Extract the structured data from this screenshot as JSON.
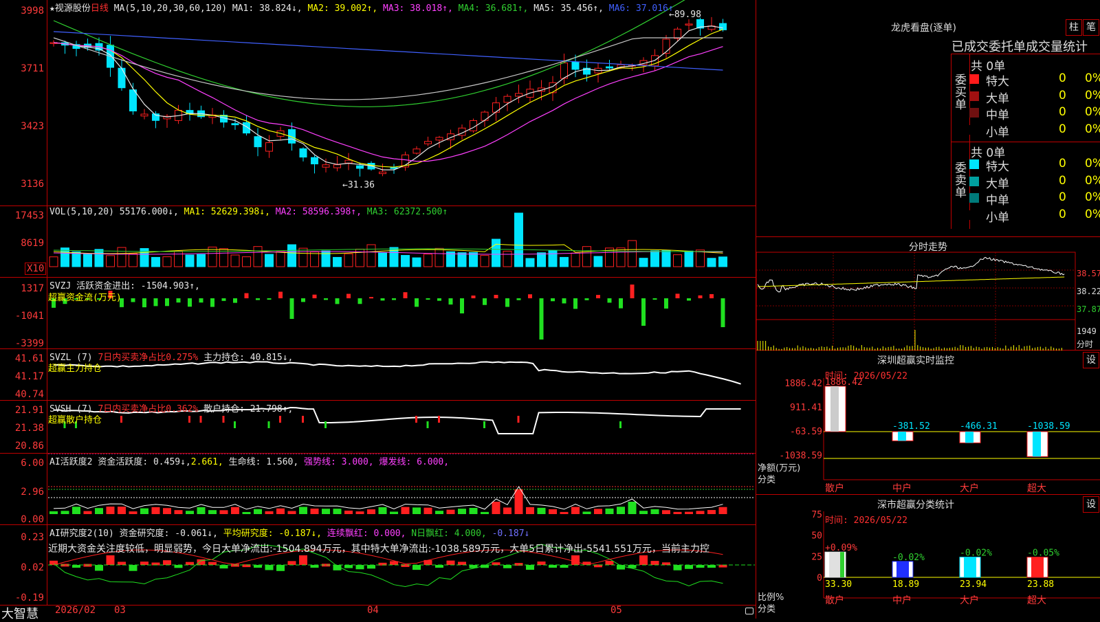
{
  "app": {
    "brand": "大智慧"
  },
  "kline": {
    "star": "★",
    "stock_name": "视源股份",
    "period": "日线",
    "ma_def": "MA(5,10,20,30,60,120)",
    "ma1": "MA1: 38.824↓,",
    "ma2": "MA2: 39.002↑,",
    "ma3": "MA3: 38.018↑,",
    "ma4": "MA4: 36.681↑,",
    "ma5": "MA5: 35.456↑,",
    "ma6": "MA6: 37.016↑",
    "y_ticks": [
      "3998",
      "3711",
      "3423",
      "3136"
    ],
    "high_label": "←89.98",
    "low_label": "←31.36",
    "colors": {
      "up": "#ff2020",
      "down": "#00e5ff",
      "ma1": "#e8e8e8",
      "ma2": "#ffff00",
      "ma3": "#ff40ff",
      "ma4": "#30d030",
      "ma5": "#4060ff",
      "ma6": "#c8c8c8"
    }
  },
  "vol": {
    "label": "VOL(5,10,20)",
    "value": "55176.000↓,",
    "ma1": "MA1: 52629.398↓,",
    "ma2": "MA2: 58596.398↑,",
    "ma3": "MA3: 62372.500↑",
    "y_ticks": [
      "17453",
      "8619"
    ],
    "multiplier": "X10"
  },
  "svzj": {
    "label": "SVZJ",
    "text": "活跃资金进出: -1504.903↑,",
    "subtitle": "超赢资金流(万元)",
    "y_ticks": [
      "1317",
      "-1041",
      "-3399"
    ]
  },
  "svzl": {
    "label": "SVZL (7)",
    "ratio": "7日内买卖净占比0.275%",
    "hold": "主力持仓: 40.815↓,",
    "subtitle": "超赢主力持仓",
    "y_ticks": [
      "41.61",
      "41.17",
      "40.74"
    ]
  },
  "svsh": {
    "label": "SVSH (7)",
    "ratio": "7日内买卖净占比0.362%",
    "hold": "散户持仓: 21.798↑,",
    "subtitle": "超赢散户持仓",
    "y_ticks": [
      "21.91",
      "21.38",
      "20.86"
    ]
  },
  "ai_active": {
    "label": "AI活跃度2",
    "text1": "资金活跃度: 0.459↓,",
    "text2": "2.661,",
    "text3": "生命线: 1.560,",
    "text4": "强势线: 3.000,",
    "text5": "爆发线: 6.000,",
    "y_ticks": [
      "6.00",
      "2.96",
      "0.00"
    ]
  },
  "ai_research": {
    "label": "AI研究度2(10)",
    "text1": "资金研究度: -0.061↓,",
    "text2": "平均研究度: -0.187↓,",
    "text3": "连续飘红: 0.000,",
    "text4": "N日飘红: 4.000,",
    "text5": "-0.187↓",
    "comment": "近期大资金关注度较低，明显弱势，今日大单净流出:-1504.894万元，其中特大单净流出:-1038.589万元，大单5日累计净出-5541.551万元，当前主力控",
    "y_ticks": [
      "0.23",
      "0.02",
      "-0.19"
    ]
  },
  "x_axis": {
    "labels": [
      "2026/02",
      "03",
      "04",
      "05"
    ]
  },
  "lhb": {
    "title": "龙虎看盘(逐单)",
    "btn_bar": "柱",
    "btn_pen": "笔",
    "tabs": "已成交委托单成交量统计",
    "buy_side": "委买单",
    "sell_side": "委卖单",
    "buy_total": "共 0单",
    "sell_total": "共 0单",
    "buy_rows": [
      {
        "label": "特大",
        "v1": "0",
        "v2": "0%",
        "color": "#ff1a1a"
      },
      {
        "label": "大单",
        "v1": "0",
        "v2": "0%",
        "color": "#a01010"
      },
      {
        "label": "中单",
        "v1": "0",
        "v2": "0%",
        "color": "#701010"
      },
      {
        "label": "小单",
        "v1": "0",
        "v2": "0%",
        "color": "#000000"
      }
    ],
    "sell_rows": [
      {
        "label": "特大",
        "v1": "0",
        "v2": "0%",
        "color": "#00e5ff"
      },
      {
        "label": "大单",
        "v1": "0",
        "v2": "0%",
        "color": "#00a0a0"
      },
      {
        "label": "中单",
        "v1": "0",
        "v2": "0%",
        "color": "#007a7a"
      },
      {
        "label": "小单",
        "v1": "0",
        "v2": "0%",
        "color": "#000000"
      }
    ]
  },
  "intraday": {
    "title": "分时走势",
    "y_ticks": [
      "38.57",
      "38.22",
      "37.87"
    ],
    "vol_tick": "1949",
    "vol_unit": "分时"
  },
  "monitor": {
    "title": "深圳超赢实时监控",
    "btn": "设",
    "date": "时间: 2026/05/22",
    "y_ticks": [
      "1886.42",
      "911.41",
      "-63.59",
      "-1038.59"
    ],
    "y_unit": "净额(万元)",
    "x_unit": "分类",
    "categories": [
      "散户",
      "中户",
      "大户",
      "超大"
    ],
    "values": [
      1886.42,
      -381.52,
      -466.31,
      -1038.59
    ],
    "value_labels": [
      "1886.42",
      "-381.52",
      "-466.31",
      "-1038.59"
    ]
  },
  "classify": {
    "title": "深市超赢分类统计",
    "btn": "设",
    "date": "时间: 2026/05/22",
    "y_ticks": [
      "75",
      "50",
      "25",
      "0"
    ],
    "y_unit": "比例%",
    "x_unit": "分类",
    "categories": [
      "散户",
      "中户",
      "大户",
      "超大"
    ],
    "values": [
      33.3,
      18.89,
      23.94,
      23.88
    ],
    "value_labels": [
      "33.30",
      "18.89",
      "23.94",
      "23.88"
    ],
    "change_labels": [
      "+0.09%",
      "-0.02%",
      "-0.02%",
      "-0.05%"
    ],
    "bar_colors": [
      "#e0e0e0",
      "#2030ff",
      "#00e5ff",
      "#ff2020"
    ]
  }
}
